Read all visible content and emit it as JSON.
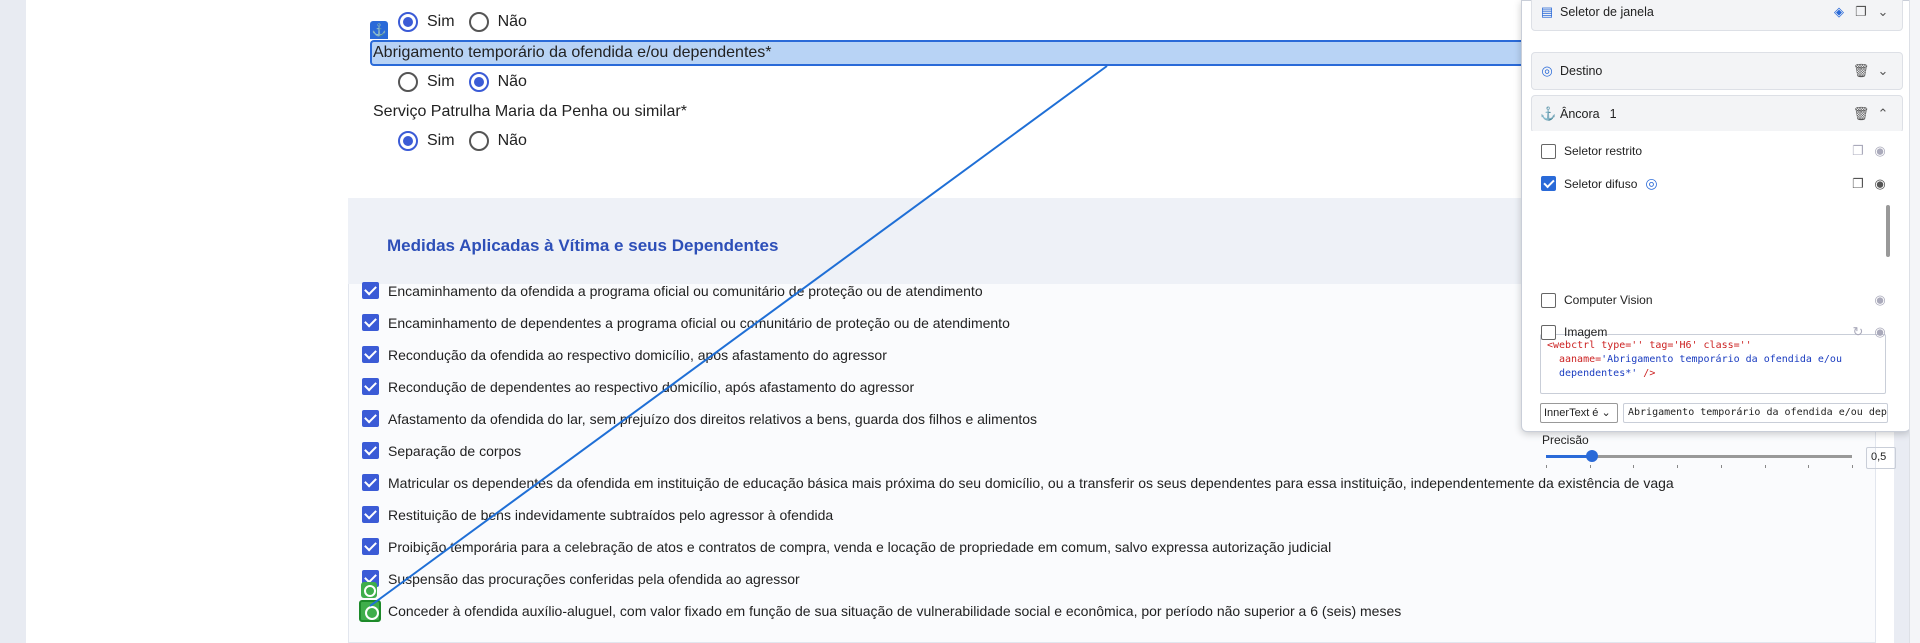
{
  "form": {
    "top_options": {
      "sim": "Sim",
      "nao": "Não",
      "selected": "sim"
    },
    "questions": [
      {
        "label": "Abrigamento temporário da ofendida e/ou dependentes*",
        "sim": "Sim",
        "nao": "Não",
        "selected": "nao"
      },
      {
        "label": "Serviço Patrulha Maria da Penha ou similar*",
        "sim": "Sim",
        "nao": "Não",
        "selected": "sim"
      }
    ],
    "anchor_tag_icon": "anchor-icon"
  },
  "section": {
    "title": "Medidas Aplicadas à Vítima e seus Dependentes",
    "items": [
      "Encaminhamento da ofendida a programa oficial ou comunitário de proteção ou de atendimento",
      "Encaminhamento de dependentes a programa oficial ou comunitário de proteção ou de atendimento",
      "Recondução da ofendida ao respectivo domicílio, após afastamento do agressor",
      "Recondução de dependentes ao respectivo domicílio, após afastamento do agressor",
      "Afastamento da ofendida do lar, sem prejuízo dos direitos relativos a bens, guarda dos filhos e alimentos",
      "Separação de corpos",
      "Matricular os dependentes da ofendida em instituição de educação básica mais próxima do seu domicílio, ou a transferir os seus dependentes para essa instituição, independentemente da existência de vaga",
      "Restituição de bens indevidamente subtraídos pelo agressor à ofendida",
      "Proibição temporária para a celebração de atos e contratos de compra, venda e locação de propriedade em comum, salvo expressa autorização judicial",
      "Suspensão das procurações conferidas pela ofendida ao agressor",
      "Conceder à ofendida auxílio-aluguel, com valor fixado em função de sua situação de vulnerabilidade social e econômica, por período não superior a 6 (seis) meses"
    ]
  },
  "panel": {
    "window_selector": {
      "label": "Seletor de janela",
      "icon": "window-icon"
    },
    "target": {
      "label": "Destino",
      "icon": "target-icon"
    },
    "anchor": {
      "label": "Âncora",
      "count": "1",
      "icon": "anchor-icon"
    },
    "options": {
      "strict": {
        "label": "Seletor restrito",
        "checked": false
      },
      "fuzzy": {
        "label": "Seletor difuso",
        "checked": true
      },
      "cv": {
        "label": "Computer Vision",
        "checked": false
      },
      "image": {
        "label": "Imagem",
        "checked": false
      }
    },
    "code": {
      "line1_tag": "<webctrl",
      "line1_attrs": " type='' tag='H6' class=''",
      "line2_key": "aaname=",
      "line2_val": "'Abrigamento temporário da ofendida e/ou",
      "line3_val": "dependentes*'",
      "line3_end": " />"
    },
    "property_select": "InnerText é",
    "property_value": "Abrigamento temporário da ofendida e/ou dep",
    "precision_label": "Precisão",
    "precision_value": "0,5",
    "precision_fraction": 0.15
  },
  "colors": {
    "accent": "#3b5bd6",
    "highlight": "#b8d3f5",
    "connector": "#1f6fd6",
    "target_green": "#3fae4b"
  }
}
